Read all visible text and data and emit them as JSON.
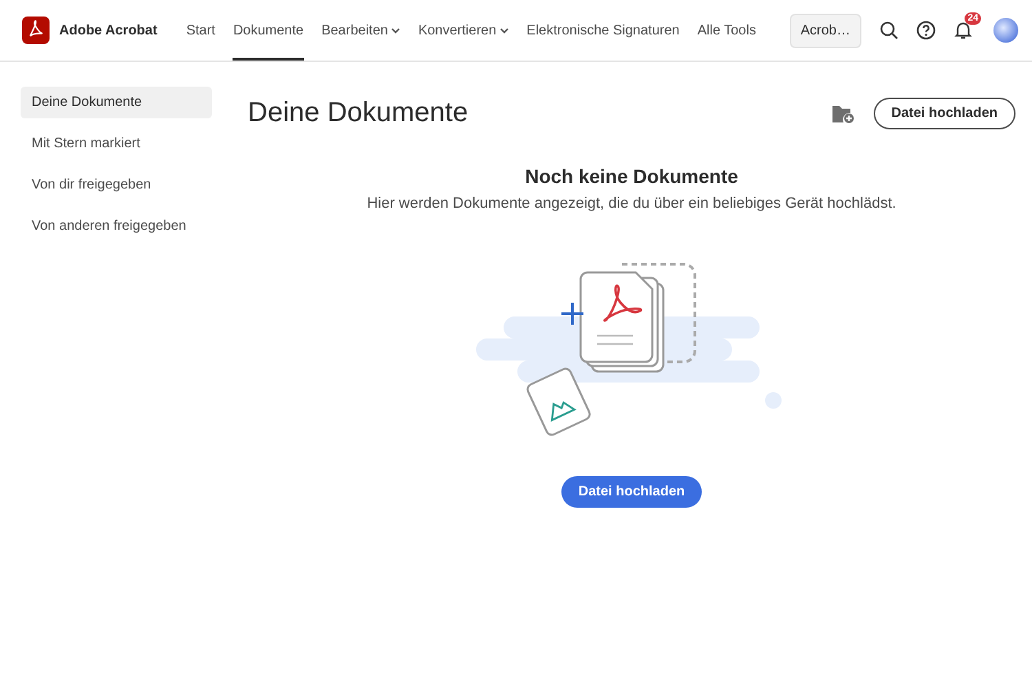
{
  "app": {
    "name": "Adobe Acrobat"
  },
  "nav": [
    {
      "label": "Start",
      "selected": false,
      "dropdown": false
    },
    {
      "label": "Dokumente",
      "selected": true,
      "dropdown": false
    },
    {
      "label": "Bearbeiten",
      "selected": false,
      "dropdown": true
    },
    {
      "label": "Konvertieren",
      "selected": false,
      "dropdown": true
    },
    {
      "label": "Elektronische Signaturen",
      "selected": false,
      "dropdown": false
    },
    {
      "label": "Alle Tools",
      "selected": false,
      "dropdown": false
    }
  ],
  "search": {
    "value": "Acrob…"
  },
  "notifications": {
    "badge": "24"
  },
  "sidebar": {
    "items": [
      {
        "label": "Deine Dokumente",
        "selected": true
      },
      {
        "label": "Mit Stern markiert",
        "selected": false
      },
      {
        "label": "Von dir freigegeben",
        "selected": false
      },
      {
        "label": "Von anderen freigegeben",
        "selected": false
      }
    ]
  },
  "main": {
    "title": "Deine Dokumente",
    "upload_button": "Datei hochladen",
    "empty_title": "Noch keine Dokumente",
    "empty_text": "Hier werden Dokumente angezeigt, die du über ein beliebiges Gerät hochlädst.",
    "primary_button": "Datei hochladen"
  }
}
